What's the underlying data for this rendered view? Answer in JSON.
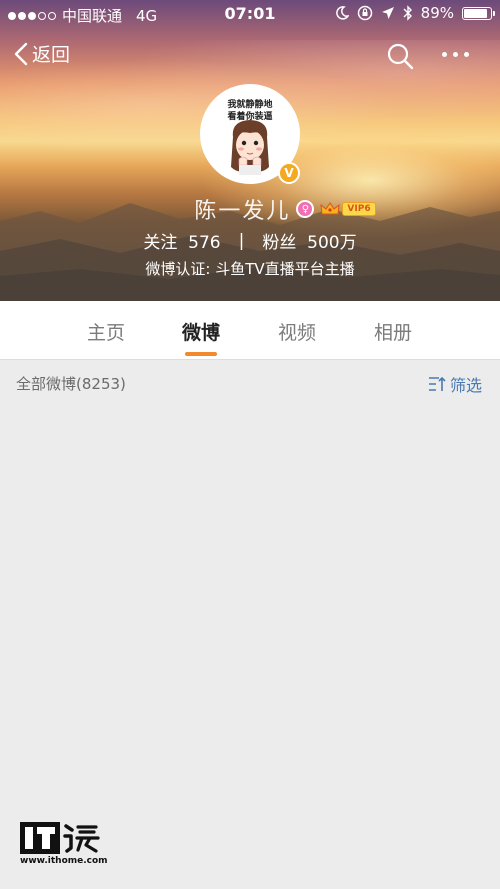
{
  "status_bar": {
    "carrier": "中国联通",
    "network": "4G",
    "time": "07:01",
    "battery": "89%",
    "battery_level": 0.89
  },
  "nav": {
    "back_label": "返回"
  },
  "avatar": {
    "caption_line1": "我就静静地",
    "caption_line2": "看着你装逼"
  },
  "profile": {
    "name": "陈一发儿",
    "verified_mark": "V",
    "vip_label": "VIP6",
    "following_label": "关注",
    "following_count": "576",
    "separator": "|",
    "followers_label": "粉丝",
    "followers_count": "500万",
    "verification": "微博认证: 斗鱼TV直播平台主播"
  },
  "tabs": [
    {
      "label": "主页",
      "active": false
    },
    {
      "label": "微博",
      "active": true
    },
    {
      "label": "视频",
      "active": false
    },
    {
      "label": "相册",
      "active": false
    }
  ],
  "feed": {
    "count_label": "全部微博(8253)",
    "filter_label": "筛选"
  },
  "watermark": {
    "url": "www.ithome.com"
  },
  "colors": {
    "accent": "#f08a2c",
    "link": "#4a7ab3",
    "background": "#ececec"
  }
}
